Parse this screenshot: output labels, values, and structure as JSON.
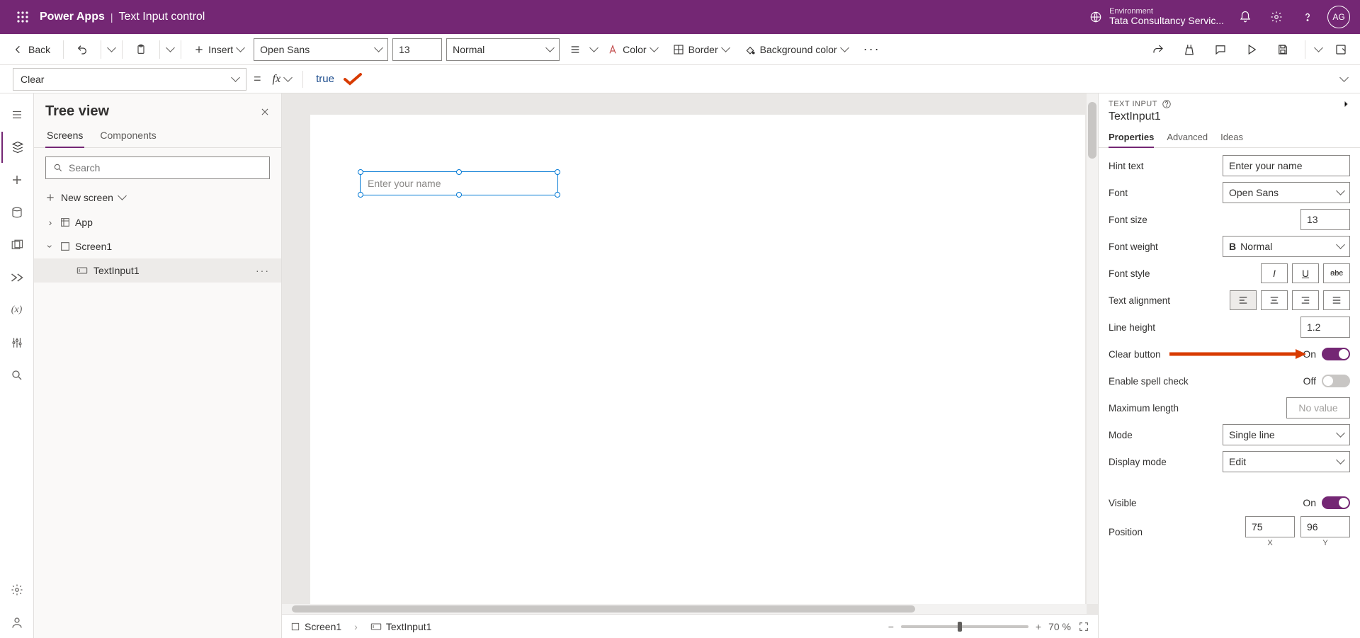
{
  "header": {
    "appTitle": "Power Apps",
    "separator": "|",
    "pageTitle": "Text Input control",
    "envLabel": "Environment",
    "envValue": "Tata Consultancy Servic...",
    "avatar": "AG"
  },
  "cmd": {
    "back": "Back",
    "insert": "Insert",
    "font": "Open Sans",
    "size": "13",
    "weight": "Normal",
    "color": "Color",
    "border": "Border",
    "bgcolor": "Background color"
  },
  "formula": {
    "property": "Clear",
    "fx": "fx",
    "value": "true"
  },
  "tree": {
    "title": "Tree view",
    "tabScreens": "Screens",
    "tabComponents": "Components",
    "searchPlaceholder": "Search",
    "newScreen": "New screen",
    "app": "App",
    "screen": "Screen1",
    "control": "TextInput1"
  },
  "canvas": {
    "placeholder": "Enter your name",
    "bcScreen": "Screen1",
    "bcControl": "TextInput1",
    "zoom": "70  %"
  },
  "props": {
    "typeLabel": "TEXT INPUT",
    "name": "TextInput1",
    "tabProps": "Properties",
    "tabAdv": "Advanced",
    "tabIdeas": "Ideas",
    "hintLabel": "Hint text",
    "hintValue": "Enter your name",
    "fontLabel": "Font",
    "fontValue": "Open Sans",
    "fontSizeLabel": "Font size",
    "fontSizeValue": "13",
    "fontWeightLabel": "Font weight",
    "fontWeightValue": "Normal",
    "fontStyleLabel": "Font style",
    "textAlignLabel": "Text alignment",
    "lineHeightLabel": "Line height",
    "lineHeightValue": "1.2",
    "clearBtnLabel": "Clear button",
    "clearBtnState": "On",
    "spellLabel": "Enable spell check",
    "spellState": "Off",
    "maxLenLabel": "Maximum length",
    "maxLenValue": "No value",
    "modeLabel": "Mode",
    "modeValue": "Single line",
    "dispModeLabel": "Display mode",
    "dispModeValue": "Edit",
    "visibleLabel": "Visible",
    "visibleState": "On",
    "positionLabel": "Position",
    "posX": "75",
    "posY": "96",
    "axisX": "X",
    "axisY": "Y"
  }
}
